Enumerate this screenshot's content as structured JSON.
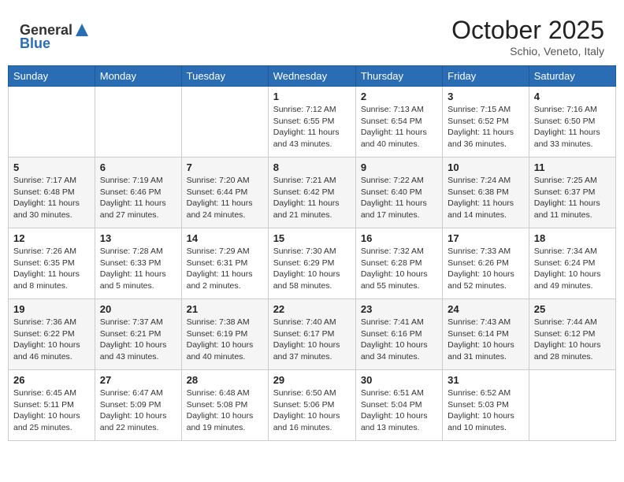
{
  "logo": {
    "general": "General",
    "blue": "Blue"
  },
  "header": {
    "month": "October 2025",
    "location": "Schio, Veneto, Italy"
  },
  "weekdays": [
    "Sunday",
    "Monday",
    "Tuesday",
    "Wednesday",
    "Thursday",
    "Friday",
    "Saturday"
  ],
  "weeks": [
    [
      {
        "day": "",
        "info": ""
      },
      {
        "day": "",
        "info": ""
      },
      {
        "day": "",
        "info": ""
      },
      {
        "day": "1",
        "info": "Sunrise: 7:12 AM\nSunset: 6:55 PM\nDaylight: 11 hours and 43 minutes."
      },
      {
        "day": "2",
        "info": "Sunrise: 7:13 AM\nSunset: 6:54 PM\nDaylight: 11 hours and 40 minutes."
      },
      {
        "day": "3",
        "info": "Sunrise: 7:15 AM\nSunset: 6:52 PM\nDaylight: 11 hours and 36 minutes."
      },
      {
        "day": "4",
        "info": "Sunrise: 7:16 AM\nSunset: 6:50 PM\nDaylight: 11 hours and 33 minutes."
      }
    ],
    [
      {
        "day": "5",
        "info": "Sunrise: 7:17 AM\nSunset: 6:48 PM\nDaylight: 11 hours and 30 minutes."
      },
      {
        "day": "6",
        "info": "Sunrise: 7:19 AM\nSunset: 6:46 PM\nDaylight: 11 hours and 27 minutes."
      },
      {
        "day": "7",
        "info": "Sunrise: 7:20 AM\nSunset: 6:44 PM\nDaylight: 11 hours and 24 minutes."
      },
      {
        "day": "8",
        "info": "Sunrise: 7:21 AM\nSunset: 6:42 PM\nDaylight: 11 hours and 21 minutes."
      },
      {
        "day": "9",
        "info": "Sunrise: 7:22 AM\nSunset: 6:40 PM\nDaylight: 11 hours and 17 minutes."
      },
      {
        "day": "10",
        "info": "Sunrise: 7:24 AM\nSunset: 6:38 PM\nDaylight: 11 hours and 14 minutes."
      },
      {
        "day": "11",
        "info": "Sunrise: 7:25 AM\nSunset: 6:37 PM\nDaylight: 11 hours and 11 minutes."
      }
    ],
    [
      {
        "day": "12",
        "info": "Sunrise: 7:26 AM\nSunset: 6:35 PM\nDaylight: 11 hours and 8 minutes."
      },
      {
        "day": "13",
        "info": "Sunrise: 7:28 AM\nSunset: 6:33 PM\nDaylight: 11 hours and 5 minutes."
      },
      {
        "day": "14",
        "info": "Sunrise: 7:29 AM\nSunset: 6:31 PM\nDaylight: 11 hours and 2 minutes."
      },
      {
        "day": "15",
        "info": "Sunrise: 7:30 AM\nSunset: 6:29 PM\nDaylight: 10 hours and 58 minutes."
      },
      {
        "day": "16",
        "info": "Sunrise: 7:32 AM\nSunset: 6:28 PM\nDaylight: 10 hours and 55 minutes."
      },
      {
        "day": "17",
        "info": "Sunrise: 7:33 AM\nSunset: 6:26 PM\nDaylight: 10 hours and 52 minutes."
      },
      {
        "day": "18",
        "info": "Sunrise: 7:34 AM\nSunset: 6:24 PM\nDaylight: 10 hours and 49 minutes."
      }
    ],
    [
      {
        "day": "19",
        "info": "Sunrise: 7:36 AM\nSunset: 6:22 PM\nDaylight: 10 hours and 46 minutes."
      },
      {
        "day": "20",
        "info": "Sunrise: 7:37 AM\nSunset: 6:21 PM\nDaylight: 10 hours and 43 minutes."
      },
      {
        "day": "21",
        "info": "Sunrise: 7:38 AM\nSunset: 6:19 PM\nDaylight: 10 hours and 40 minutes."
      },
      {
        "day": "22",
        "info": "Sunrise: 7:40 AM\nSunset: 6:17 PM\nDaylight: 10 hours and 37 minutes."
      },
      {
        "day": "23",
        "info": "Sunrise: 7:41 AM\nSunset: 6:16 PM\nDaylight: 10 hours and 34 minutes."
      },
      {
        "day": "24",
        "info": "Sunrise: 7:43 AM\nSunset: 6:14 PM\nDaylight: 10 hours and 31 minutes."
      },
      {
        "day": "25",
        "info": "Sunrise: 7:44 AM\nSunset: 6:12 PM\nDaylight: 10 hours and 28 minutes."
      }
    ],
    [
      {
        "day": "26",
        "info": "Sunrise: 6:45 AM\nSunset: 5:11 PM\nDaylight: 10 hours and 25 minutes."
      },
      {
        "day": "27",
        "info": "Sunrise: 6:47 AM\nSunset: 5:09 PM\nDaylight: 10 hours and 22 minutes."
      },
      {
        "day": "28",
        "info": "Sunrise: 6:48 AM\nSunset: 5:08 PM\nDaylight: 10 hours and 19 minutes."
      },
      {
        "day": "29",
        "info": "Sunrise: 6:50 AM\nSunset: 5:06 PM\nDaylight: 10 hours and 16 minutes."
      },
      {
        "day": "30",
        "info": "Sunrise: 6:51 AM\nSunset: 5:04 PM\nDaylight: 10 hours and 13 minutes."
      },
      {
        "day": "31",
        "info": "Sunrise: 6:52 AM\nSunset: 5:03 PM\nDaylight: 10 hours and 10 minutes."
      },
      {
        "day": "",
        "info": ""
      }
    ]
  ]
}
